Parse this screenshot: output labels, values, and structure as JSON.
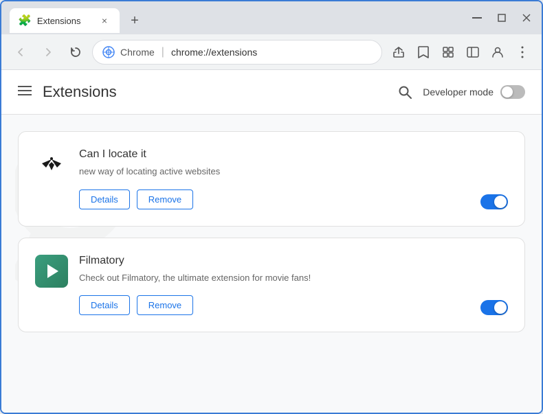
{
  "window": {
    "title": "Extensions",
    "tab_close": "×",
    "new_tab": "+",
    "ctrl_minimize": "—",
    "ctrl_maximize": "□",
    "ctrl_close": "×"
  },
  "nav": {
    "back": "←",
    "forward": "→",
    "refresh": "↻",
    "browser_name": "Chrome",
    "url": "chrome://extensions",
    "separator": "|"
  },
  "header": {
    "menu": "≡",
    "title": "Extensions",
    "search_label": "🔍",
    "dev_mode_label": "Developer mode"
  },
  "watermark": {
    "text": "FIASH.COM"
  },
  "extensions": [
    {
      "id": "ext-1",
      "name": "Can I locate it",
      "description": "new way of locating active websites",
      "details_label": "Details",
      "remove_label": "Remove",
      "enabled": true,
      "icon_type": "locate"
    },
    {
      "id": "ext-2",
      "name": "Filmatory",
      "description": "Check out Filmatory, the ultimate extension for movie fans!",
      "details_label": "Details",
      "remove_label": "Remove",
      "enabled": true,
      "icon_type": "filmatory"
    }
  ]
}
